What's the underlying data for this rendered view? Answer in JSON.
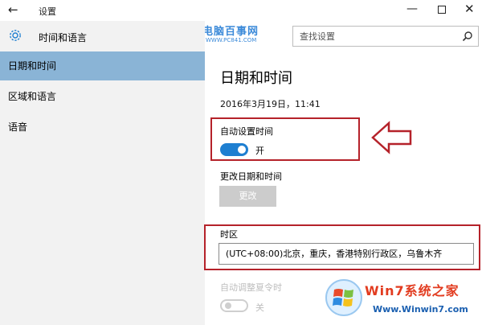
{
  "window": {
    "title": "设置",
    "back_icon": "arrow-left-icon",
    "controls": [
      "minimize-icon",
      "maximize-icon",
      "close-icon"
    ]
  },
  "watermark_top": {
    "name": "电脑百事网",
    "url": "WWW.PC841.COM"
  },
  "sidebar": {
    "header": {
      "icon": "gear-icon",
      "title": "时间和语言"
    },
    "items": [
      {
        "label": "日期和时间",
        "active": true
      },
      {
        "label": "区域和语言",
        "active": false
      },
      {
        "label": "语音",
        "active": false
      }
    ]
  },
  "search": {
    "placeholder": "查找设置",
    "icon": "search-icon"
  },
  "main": {
    "title": "日期和时间",
    "current_datetime": "2016年3月19日，11:41",
    "auto_time": {
      "label": "自动设置时间",
      "state": "开",
      "on": true
    },
    "change_datetime": {
      "label": "更改日期和时间",
      "button": "更改"
    },
    "timezone": {
      "label": "时区",
      "value": "(UTC+08:00)北京，重庆，香港特别行政区，乌鲁木齐"
    },
    "dst": {
      "label": "自动调整夏令时",
      "state": "关",
      "on": false
    }
  },
  "watermark_bottom": {
    "name": "Win7系统之家",
    "url": "Www.Winwin7.com"
  },
  "colors": {
    "accent": "#1e7fd1",
    "sidebar_active": "#8ab4d6",
    "sidebar_bg": "#f2f2f2",
    "annotation_red": "#b5222a",
    "disabled_button": "#cccccc"
  }
}
